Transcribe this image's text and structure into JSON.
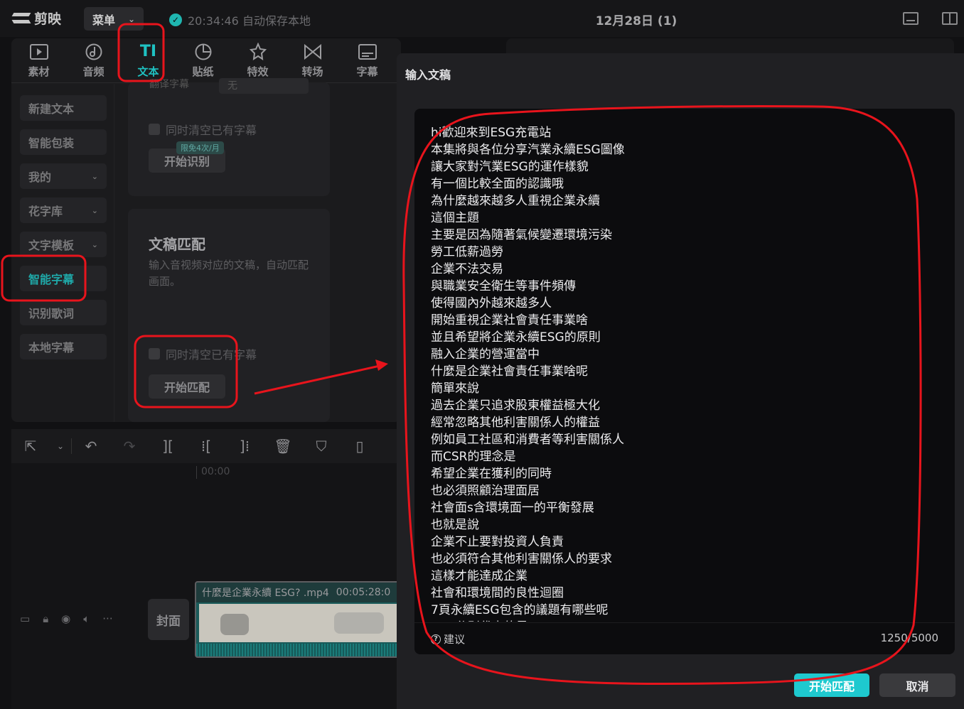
{
  "app": {
    "logo_text": "剪映",
    "menu_label": "菜单",
    "save_status": "20:34:46 自动保存本地",
    "project_title": "12月28日 (1)"
  },
  "tabs": [
    {
      "label": "素材",
      "icon": "media-icon"
    },
    {
      "label": "音频",
      "icon": "audio-icon"
    },
    {
      "label": "文本",
      "icon": "text-icon",
      "active": true
    },
    {
      "label": "贴纸",
      "icon": "sticker-icon"
    },
    {
      "label": "特效",
      "icon": "effects-icon"
    },
    {
      "label": "转场",
      "icon": "transition-icon"
    },
    {
      "label": "字幕",
      "icon": "subtitle-icon"
    }
  ],
  "sidebar": {
    "items": [
      {
        "label": "新建文本"
      },
      {
        "label": "智能包装"
      },
      {
        "label": "我的"
      },
      {
        "label": "花字库"
      },
      {
        "label": "文字模板"
      },
      {
        "label": "智能字幕",
        "active": true
      },
      {
        "label": "识别歌词"
      },
      {
        "label": "本地字幕"
      }
    ]
  },
  "recognize_card": {
    "partial_label": "翻译字幕",
    "partial_value": "无",
    "clear_checkbox": "同时清空已有字幕",
    "badge": "限免4次/月",
    "button": "开始识别"
  },
  "match_card": {
    "title": "文稿匹配",
    "desc": "输入音视频对应的文稿，自动匹配画面。",
    "clear_checkbox": "同时清空已有字幕",
    "button": "开始匹配"
  },
  "timeline": {
    "ruler_time": "00:00",
    "cover_label": "封面",
    "clip_name": "什麼是企業永續 ESG? .mp4",
    "clip_duration": "00:05:28:0"
  },
  "dialog": {
    "title": "输入文稿",
    "lines": [
      "hi歡迎來到ESG充電站",
      "本集將與各位分享汽業永續ESG圖像",
      "讓大家對汽業ESG的運作樣貌",
      "有一個比較全面的認識哦",
      "為什麼越來越多人重視企業永續",
      "這個主題",
      "主要是因為隨著氣候變遷環境污染",
      "勞工低薪過勞",
      "企業不法交易",
      "與職業安全衛生等事件頻傳",
      "使得國內外越來越多人",
      "開始重視企業社會責任事業啥",
      "並且希望將企業永續ESG的原則",
      "融入企業的營運當中",
      "什麼是企業社會責任事業啥呢",
      "簡單來說",
      "過去企業只追求股東權益極大化",
      "經常忽略其他利害關係人的權益",
      "例如員工社區和消費者等利害關係人",
      "而CSR的理念是",
      "希望企業在獲利的同時",
      "也必須照顧治理面居",
      "社會面s含環境面一的平衡發展",
      "也就是說",
      "企業不止要對投資人負責",
      "也必須符合其他利害關係人的要求",
      "這樣才能達成企業",
      "社會和環境間的良性迴圈",
      "7頁永續ESG包含的議題有哪些呢",
      "ESG分別代表的是"
    ],
    "hint": "建议",
    "counter": "1250/5000",
    "confirm_button": "开始匹配",
    "cancel_button": "取消"
  },
  "colors": {
    "accent": "#1ec9cf",
    "annotation": "#e8141c"
  }
}
